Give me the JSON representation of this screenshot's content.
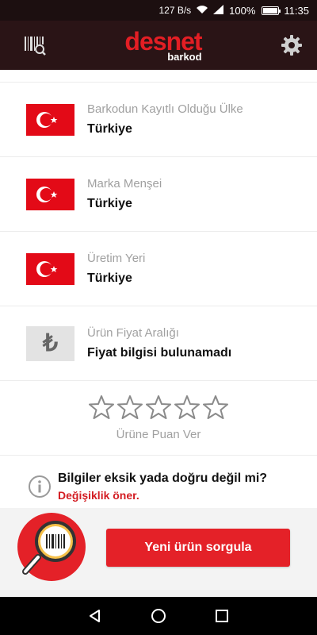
{
  "status_bar": {
    "net_speed": "127 B/s",
    "battery": "100%",
    "battery_level": 1.0,
    "time": "11:35"
  },
  "header": {
    "logo_main": "desnet",
    "logo_sub": "barkod",
    "left_icon": "barcode-search-icon",
    "right_icon": "gear-icon"
  },
  "info_rows": [
    {
      "label": "Barkodun Kayıtlı Olduğu Ülke",
      "value": "Türkiye",
      "icon": "turkey-flag"
    },
    {
      "label": "Marka Menşei",
      "value": "Türkiye",
      "icon": "turkey-flag"
    },
    {
      "label": "Üretim Yeri",
      "value": "Türkiye",
      "icon": "turkey-flag"
    },
    {
      "label": "Ürün Fiyat Aralığı",
      "value": "Fiyat bilgisi bulunamadı",
      "icon": "lira-icon",
      "icon_glyph": "₺"
    }
  ],
  "rating": {
    "stars_total": 5,
    "stars_filled": 0,
    "label": "Ürüne Puan Ver"
  },
  "report": {
    "question": "Bilgiler eksik yada doğru değil mi?",
    "link": "Değişiklik öner."
  },
  "bottom": {
    "query_button": "Yeni ürün sorgula"
  },
  "colors": {
    "brand_red": "#e31e24",
    "header_bg": "#2a1416"
  }
}
